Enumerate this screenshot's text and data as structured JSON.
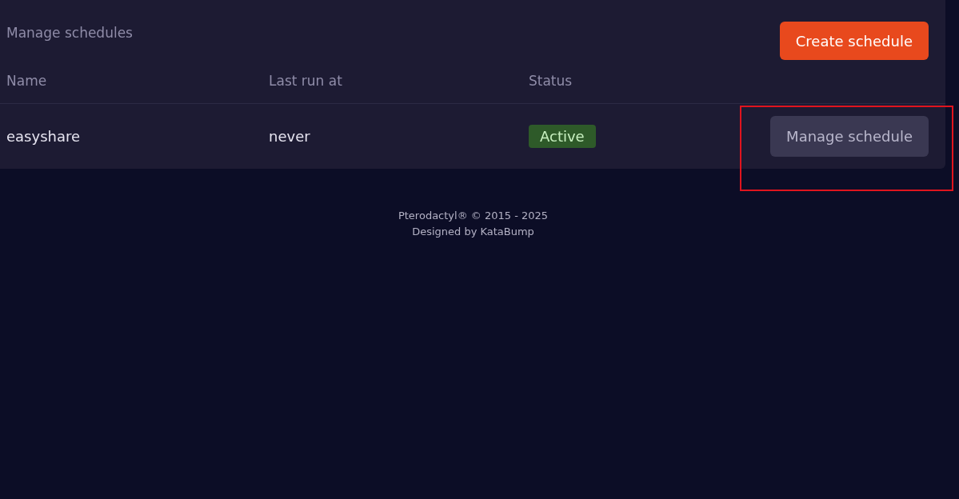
{
  "panel": {
    "title": "Manage schedules",
    "create_button": "Create schedule",
    "columns": [
      "Name",
      "Last run at",
      "Status"
    ],
    "rows": [
      {
        "name": "easyshare",
        "last_run": "never",
        "status": "Active",
        "active": true,
        "action": "Manage schedule",
        "highlighted": true
      }
    ]
  },
  "footer": {
    "copyright": "Pterodactyl® © 2015 - 2025",
    "credit": "Designed by KataBump"
  }
}
